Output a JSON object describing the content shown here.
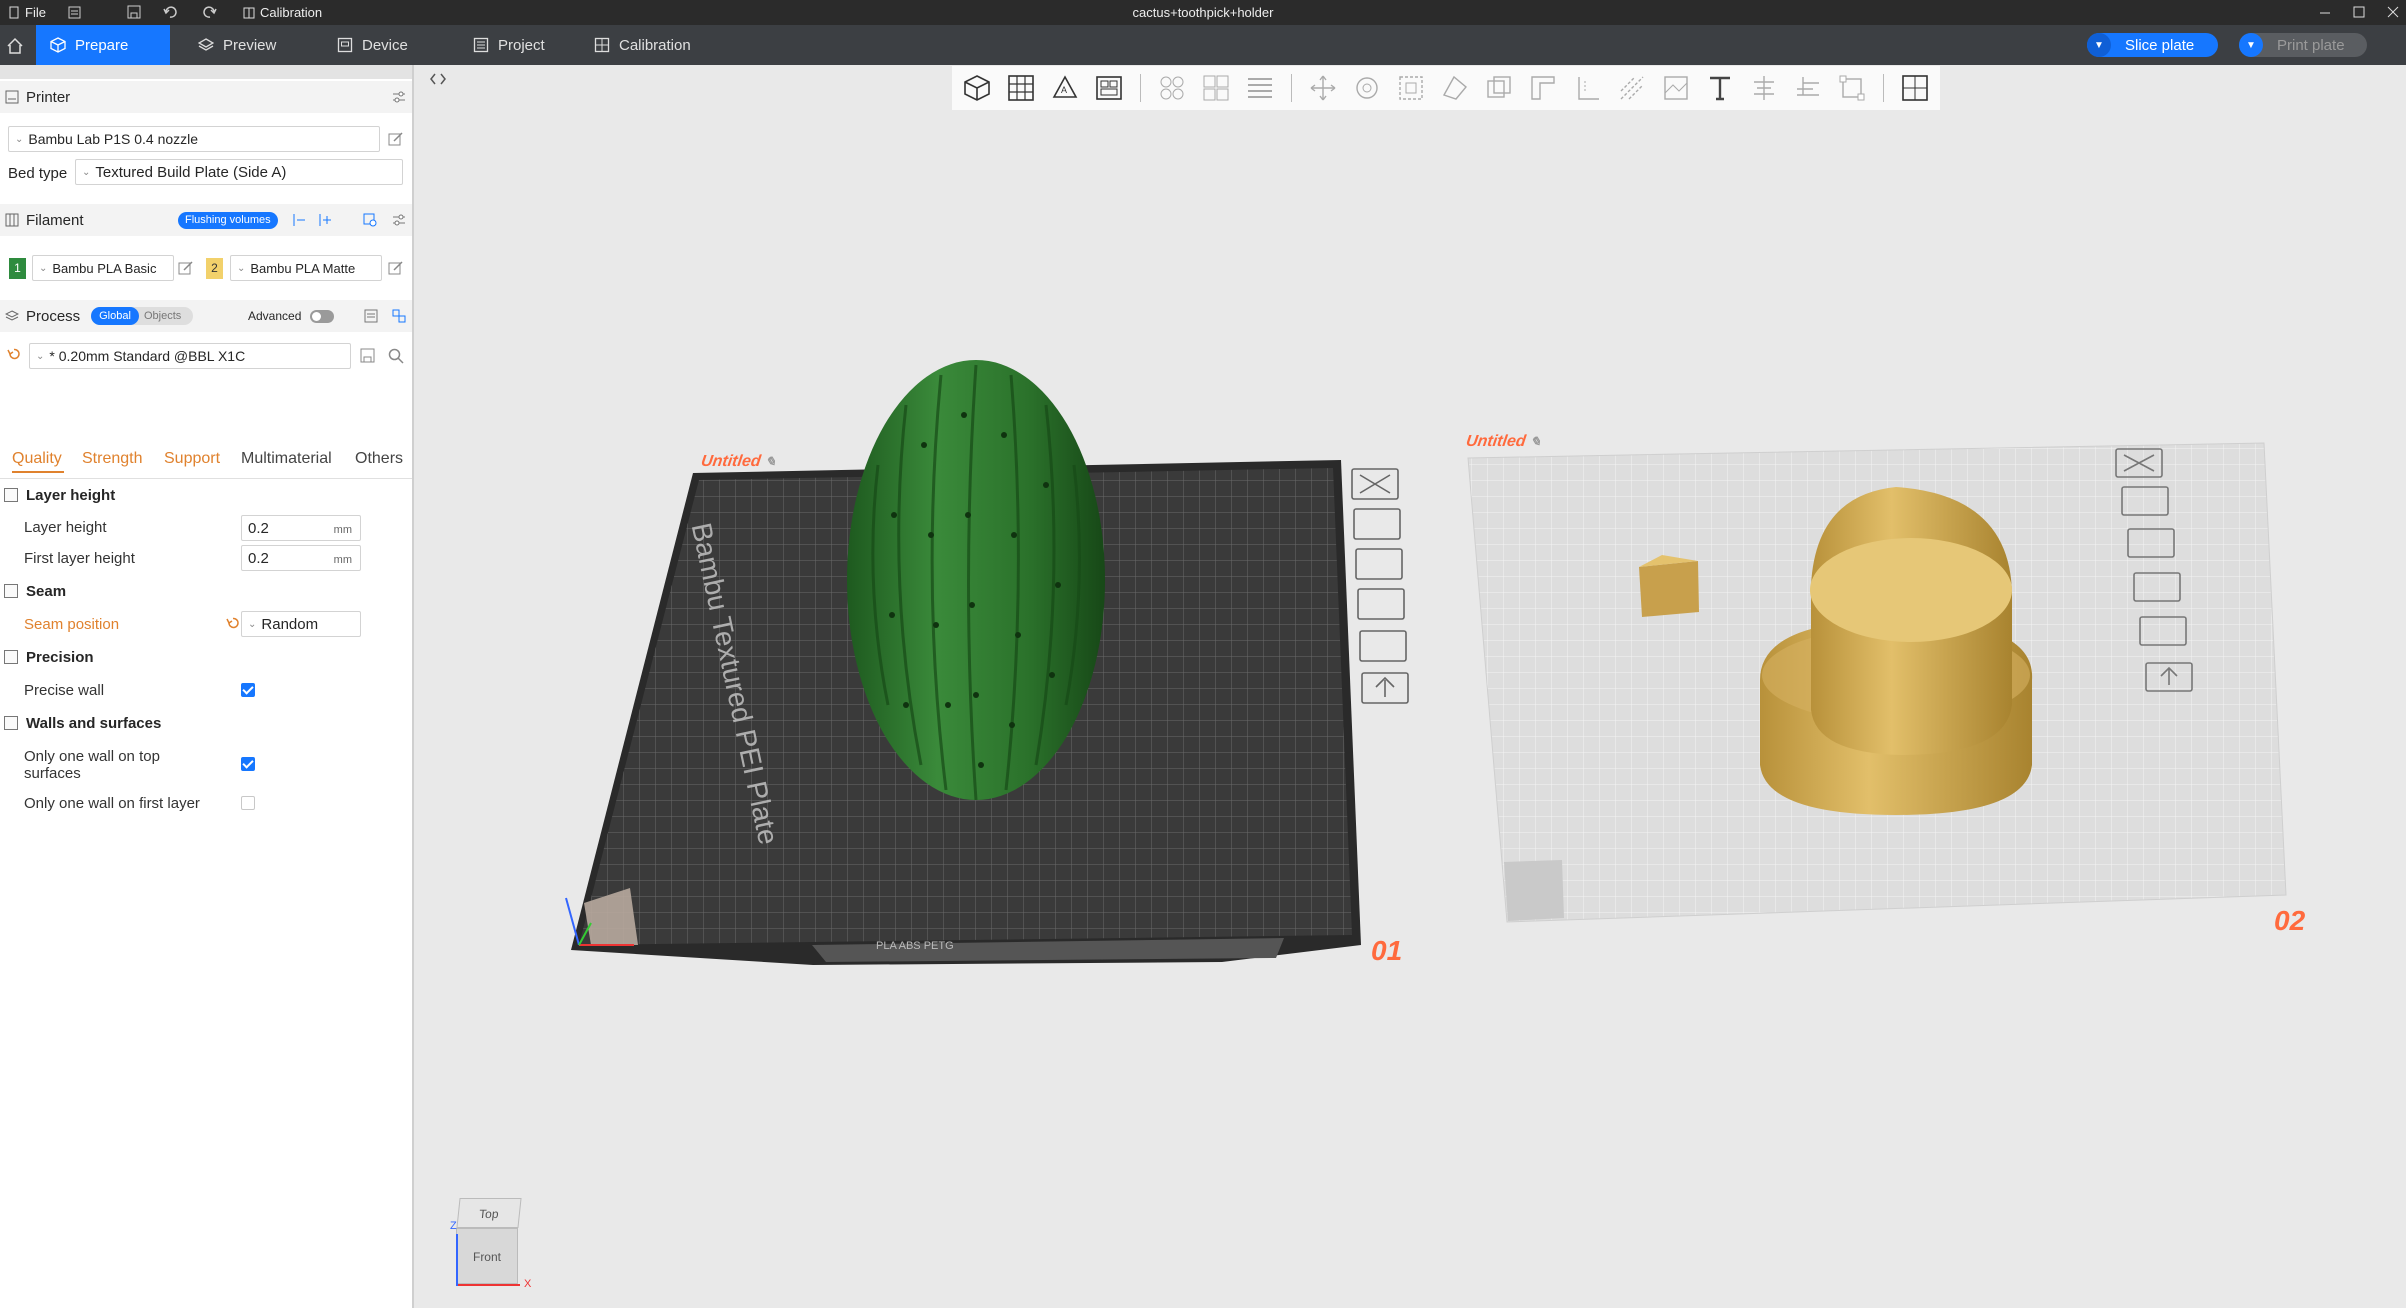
{
  "titlebar": {
    "file_label": "File",
    "calibration_label": "Calibration",
    "window_title": "cactus+toothpick+holder"
  },
  "tabs": [
    {
      "label": "Prepare",
      "icon": "cube-icon"
    },
    {
      "label": "Preview",
      "icon": "layers-icon"
    },
    {
      "label": "Device",
      "icon": "device-icon"
    },
    {
      "label": "Project",
      "icon": "project-icon"
    },
    {
      "label": "Calibration",
      "icon": "calibration-icon"
    }
  ],
  "actions": {
    "slice_label": "Slice plate",
    "print_label": "Print plate"
  },
  "printer": {
    "header": "Printer",
    "name": "Bambu Lab P1S 0.4 nozzle",
    "bed_type_label": "Bed type",
    "bed_type_value": "Textured Build Plate (Side A)"
  },
  "filament": {
    "header": "Filament",
    "flushing_label": "Flushing volumes",
    "slots": [
      {
        "index": "1",
        "name": "Bambu PLA Basic",
        "color": "#2e8b3e"
      },
      {
        "index": "2",
        "name": "Bambu PLA Matte",
        "color": "#f2d16b"
      }
    ]
  },
  "process": {
    "header": "Process",
    "toggle_global": "Global",
    "toggle_objects": "Objects",
    "advanced_label": "Advanced",
    "preset": "* 0.20mm Standard @BBL X1C",
    "tabs": [
      "Quality",
      "Strength",
      "Support",
      "Multimaterial",
      "Others"
    ]
  },
  "quality": {
    "layer_height_group": "Layer height",
    "layer_height_label": "Layer height",
    "layer_height_value": "0.2",
    "first_layer_height_label": "First layer height",
    "first_layer_height_value": "0.2",
    "unit": "mm",
    "seam_group": "Seam",
    "seam_position_label": "Seam position",
    "seam_position_value": "Random",
    "precision_group": "Precision",
    "precise_wall_label": "Precise wall",
    "precise_wall_checked": true,
    "walls_group": "Walls and surfaces",
    "one_wall_top_label_1": "Only one wall on top",
    "one_wall_top_label_2": "surfaces",
    "one_wall_top_checked": true,
    "one_wall_first_label": "Only one wall on first layer",
    "one_wall_first_checked": false
  },
  "plates": [
    {
      "name": "Untitled",
      "number": "01",
      "plate_text": "Bambu Textured PEI Plate",
      "strip_text": "PLA ABS PETG"
    },
    {
      "name": "Untitled",
      "number": "02"
    }
  ],
  "navcube": {
    "top": "Top",
    "front": "Front",
    "axis_x": "X",
    "axis_z": "Z"
  },
  "colors": {
    "accent": "#1677ff",
    "plate_label": "#ff6a3d",
    "cactus": "#2f7a30",
    "holder": "#d9b25a"
  }
}
